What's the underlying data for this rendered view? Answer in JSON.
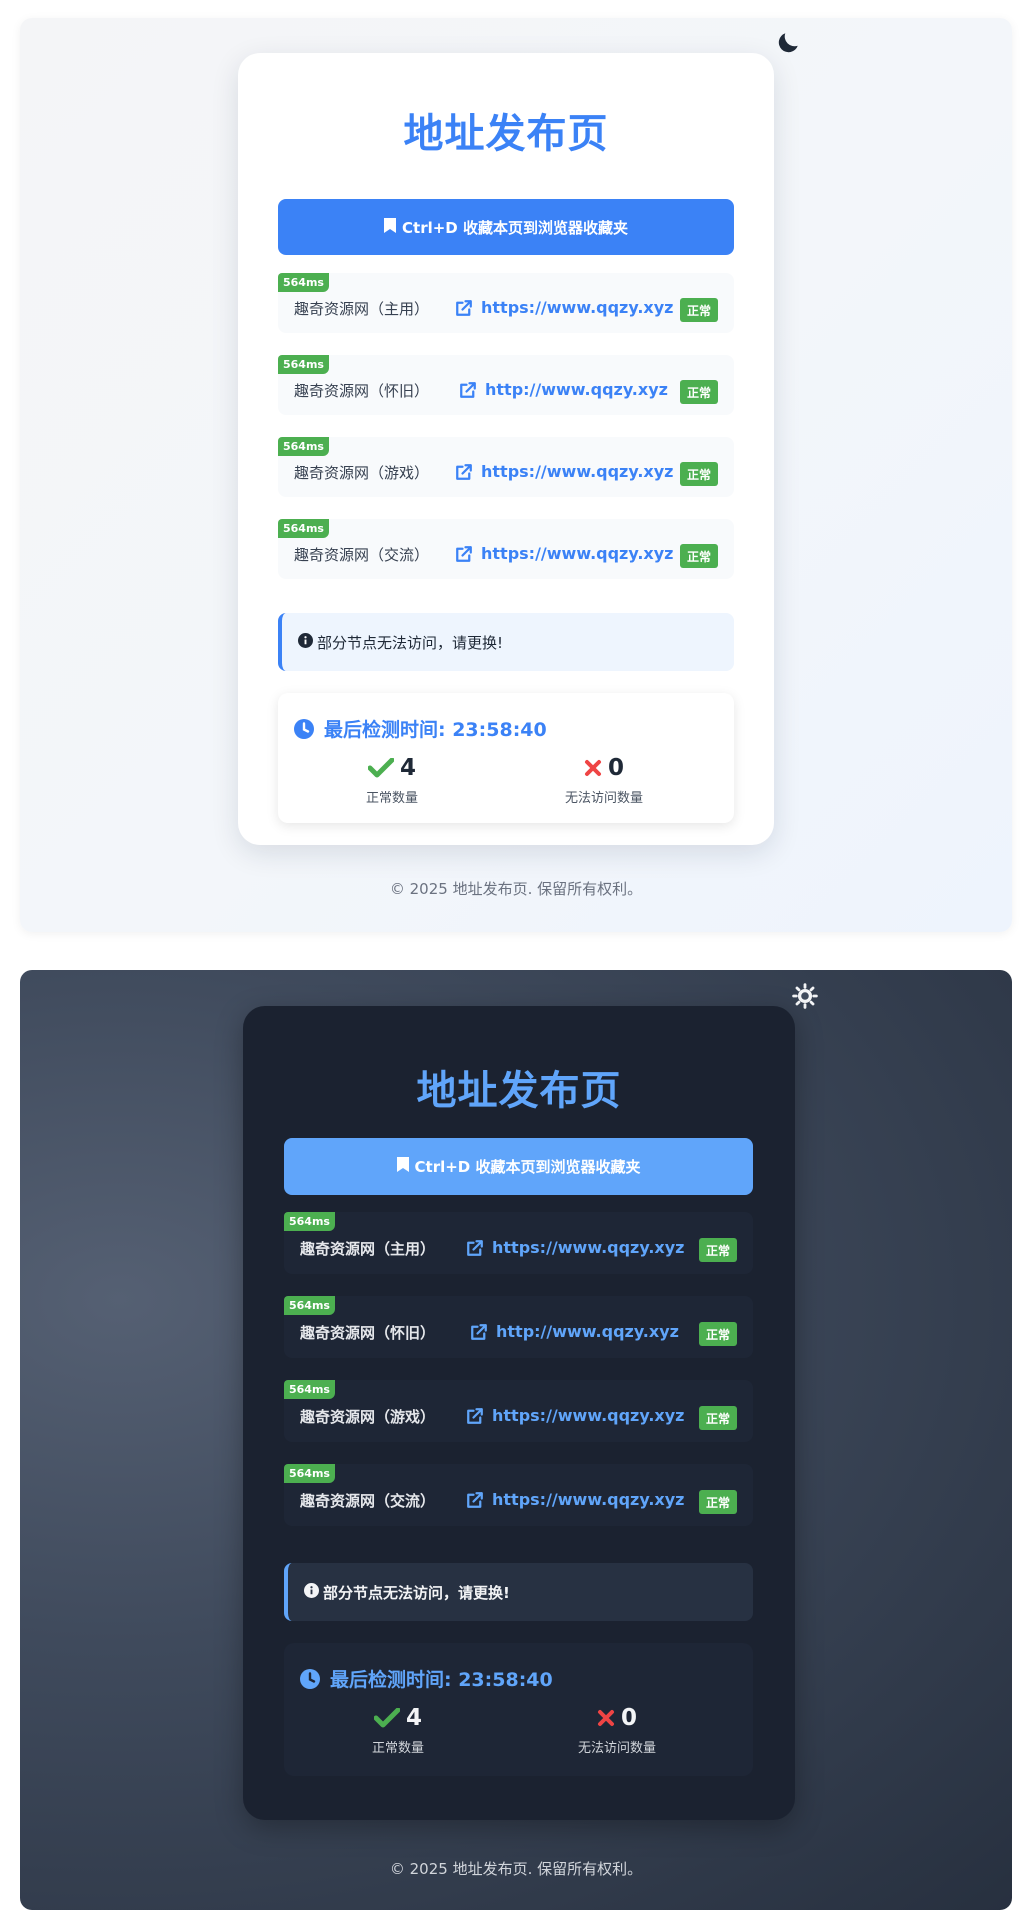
{
  "app": {
    "title": "地址发布页",
    "bookmark_label": "Ctrl+D 收藏本页到浏览器收藏夹",
    "notice": "部分节点无法访问，请更换!",
    "last_check_label": "最后检测时间: 23:58:40",
    "ok_count": "4",
    "ok_label": "正常数量",
    "fail_count": "0",
    "fail_label": "无法访问数量",
    "footer": "© 2025 地址发布页. 保留所有权利。",
    "links": [
      {
        "latency": "564ms",
        "name": "趣奇资源网（主用）",
        "url": "https://www.qqzy.xyz",
        "status": "正常"
      },
      {
        "latency": "564ms",
        "name": "趣奇资源网（怀旧）",
        "url": "http://www.qqzy.xyz",
        "status": "正常"
      },
      {
        "latency": "564ms",
        "name": "趣奇资源网（游戏）",
        "url": "https://www.qqzy.xyz",
        "status": "正常"
      },
      {
        "latency": "564ms",
        "name": "趣奇资源网（交流）",
        "url": "https://www.qqzy.xyz",
        "status": "正常"
      }
    ]
  },
  "colors": {
    "accent_light": "#3b82f6",
    "accent_dark": "#60a5fa",
    "status_green": "#4caf50",
    "fail_red": "#ef4444"
  },
  "icons": {
    "light_theme_toggle": "moon-icon",
    "dark_theme_toggle": "sun-icon",
    "bookmark": "bookmark-icon",
    "external_link": "external-link-icon",
    "notice": "info-icon",
    "clock": "clock-icon",
    "ok": "check-icon",
    "fail": "x-icon"
  }
}
